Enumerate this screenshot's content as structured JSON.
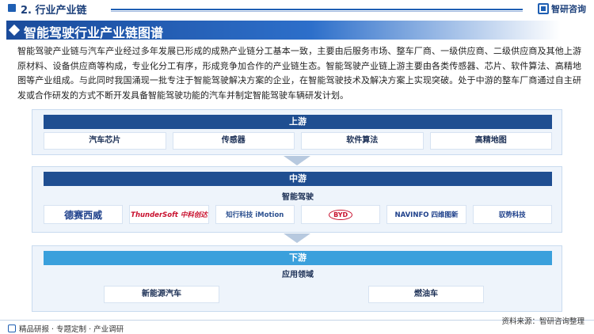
{
  "header": {
    "section": "2. 行业产业链",
    "brand": "智研咨询"
  },
  "title": "智能驾驶行业产业链图谱",
  "paragraph": "智能驾驶产业链与汽车产业经过多年发展已形成的成熟产业链分工基本一致，主要由后服务市场、整车厂商、一级供应商、二级供应商及其他上游原材料、设备供应商等构成，专业化分工有序，形成竞争加合作的产业链生态。智能驾驶产业链上游主要由各类传感器、芯片、软件算法、高精地图等产业组成。与此同时我国涌现一批专注于智能驾驶解决方案的企业，在智能驾驶技术及解决方案上实现突破。处于中游的整车厂商通过自主研发或合作研发的方式不断开发具备智能驾驶功能的汽车并制定智能驾驶车辆研发计划。",
  "diagram": {
    "upstream": {
      "label": "上游",
      "items": [
        "汽车芯片",
        "传感器",
        "软件算法",
        "高精地图"
      ]
    },
    "midstream": {
      "label": "中游",
      "sub_label": "智能驾驶",
      "logos": [
        "德赛西威",
        "ThunderSoft 中科创达",
        "知行科技 iMotion",
        "BYD",
        "NAVINFO 四维图新",
        "驭势科技"
      ]
    },
    "downstream": {
      "label": "下游",
      "sub_label": "应用领域",
      "items": [
        "新能源汽车",
        "燃油车"
      ]
    }
  },
  "footer": {
    "left": "精品研报 · 专题定制 · 产业调研",
    "source": "资料来源：智研咨询整理"
  },
  "colors": {
    "primary": "#1f4e91",
    "accent": "#3aa0dc",
    "panel": "#eef4fb"
  }
}
